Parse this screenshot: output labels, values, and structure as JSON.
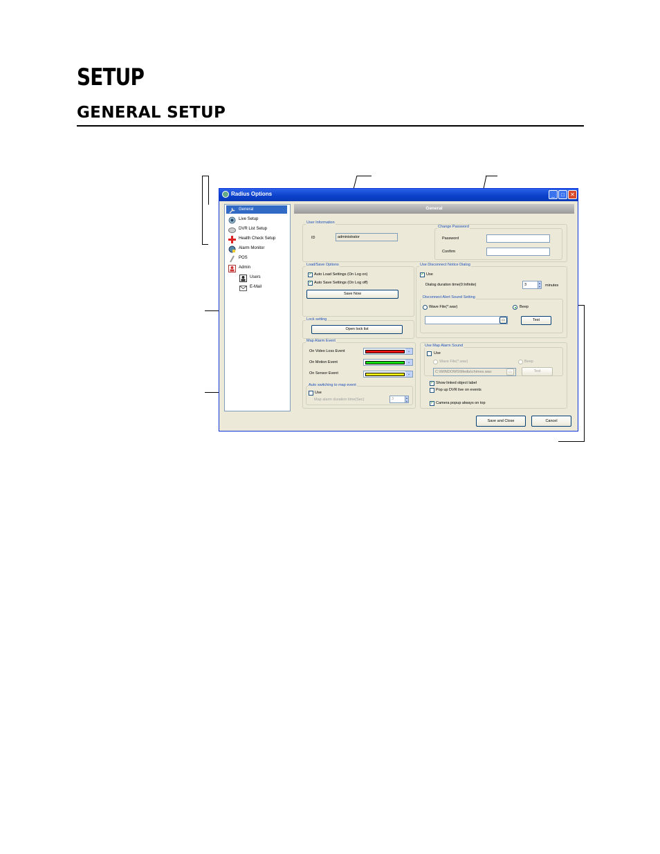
{
  "page": {
    "heading": "SETUP",
    "subheading": "GENERAL SETUP"
  },
  "window": {
    "title": "Radius Options",
    "buttons": {
      "minimize": "_",
      "maximize": "□",
      "close": "✕"
    },
    "tree": [
      {
        "label": "General",
        "icon": "wrench-icon",
        "selected": true
      },
      {
        "label": "Live Setup",
        "icon": "camera-icon"
      },
      {
        "label": "DVR List Setup",
        "icon": "dvr-icon"
      },
      {
        "label": "Health Check Setup",
        "icon": "health-cross-icon"
      },
      {
        "label": "Alarm Monitor",
        "icon": "alarm-monitor-icon"
      },
      {
        "label": "POS",
        "icon": "pos-icon"
      },
      {
        "label": "Admin",
        "icon": "admin-icon"
      },
      {
        "label": "Users",
        "icon": "user-icon"
      },
      {
        "label": "E-Mail",
        "icon": "envelope-icon"
      }
    ],
    "panel_title": "General",
    "user_info": {
      "legend": "User Information",
      "id_label": "ID",
      "id_value": "administrator"
    },
    "change_password": {
      "legend": "Change Password",
      "password_label": "Password",
      "confirm_label": "Confirm"
    },
    "load_save": {
      "legend": "Load/Save Options",
      "auto_load": "Auto Load Settings (On Log on)",
      "auto_save": "Auto Save Settings (On Log off)",
      "save_now": "Save Now"
    },
    "lock": {
      "legend": "Lock setting",
      "button": "Open lock list"
    },
    "disconnect": {
      "legend": "Use Disconnect Notice Dialog",
      "use": "Use",
      "duration_label": "Dialog duration time(0:Infinite)",
      "duration_value": "3",
      "minutes": "minutes",
      "sound_legend": "Disconnect Alert Sound Setting",
      "wave": "Wave File(*.wav)",
      "beep": "Beep",
      "test": "Test"
    },
    "map_alarm": {
      "legend": "Map Alarm Event",
      "video_loss": "On Video Loss Event",
      "motion": "On Motion Event",
      "sensor": "On Sensor Event",
      "colors": {
        "video_loss": "#ee1111",
        "motion": "#11dd11",
        "sensor": "#eeee11"
      },
      "auto_legend": "Auto switching to map event",
      "use": "Use",
      "duration_label": "Map alarm duration time(Sec)",
      "duration_value": "3"
    },
    "map_sound": {
      "legend": "Use Map Alarm Sound",
      "use": "Use",
      "wave": "Wave File(*.wav)",
      "beep": "Beep",
      "path": "C:\\WINDOWS\\Media\\chimes.wav",
      "test": "Test",
      "show_linked": "Show linked object label",
      "popup_dvr": "Pop up DVR live on events",
      "camera_top": "Camera popup always on top"
    },
    "save_close": "Save and Close",
    "cancel": "Cancel"
  }
}
